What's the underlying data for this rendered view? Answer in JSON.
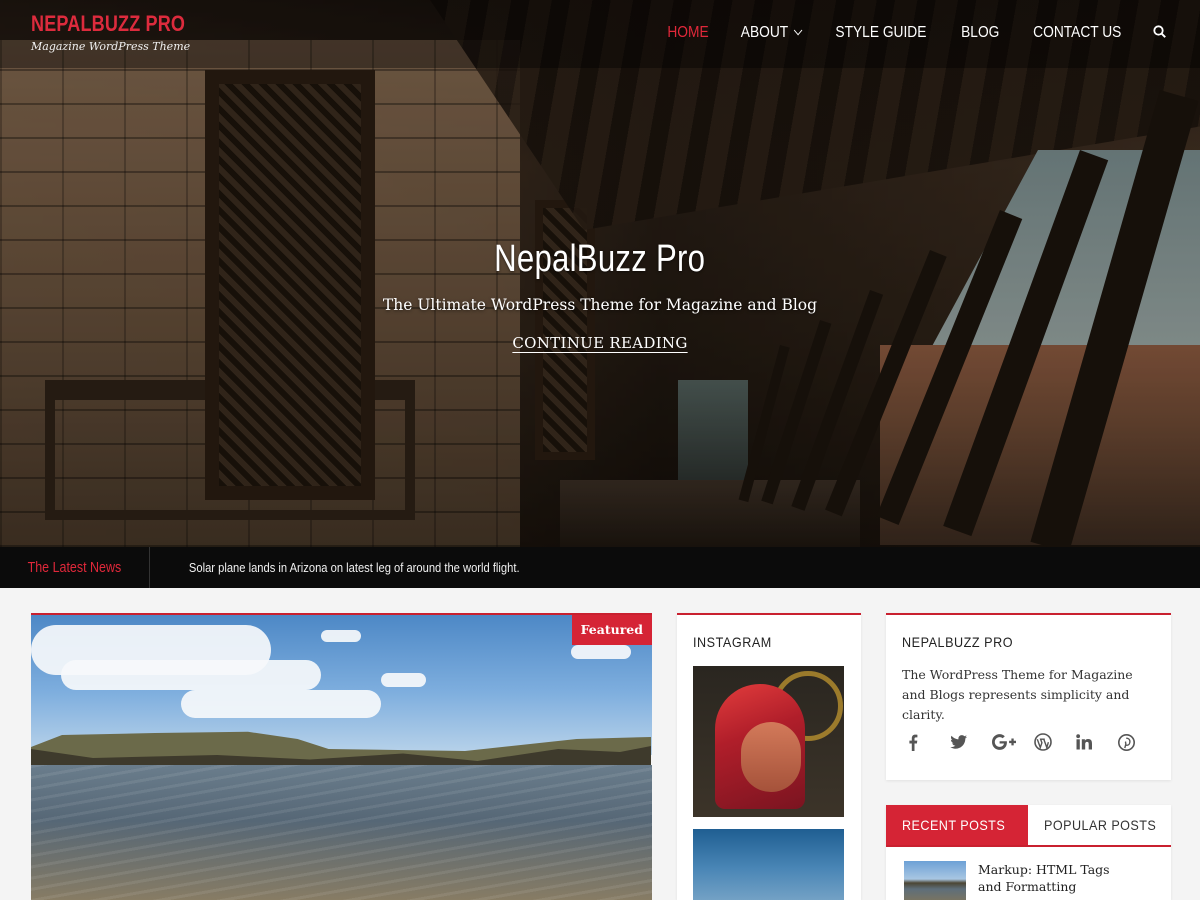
{
  "site": {
    "title": "NEPALBUZZ PRO",
    "tagline": "Magazine WordPress Theme"
  },
  "nav": {
    "items": [
      {
        "label": "HOME",
        "active": true
      },
      {
        "label": "ABOUT",
        "has_dropdown": true
      },
      {
        "label": "STYLE GUIDE"
      },
      {
        "label": "BLOG"
      },
      {
        "label": "CONTACT US"
      }
    ],
    "search_icon": "search-icon"
  },
  "hero": {
    "title": "NepalBuzz Pro",
    "subtitle": "The Ultimate WordPress Theme for Magazine and Blog",
    "cta": "CONTINUE READING"
  },
  "ticker": {
    "label": "The Latest News",
    "headline": "Solar plane lands in Arizona on latest leg of around the world flight."
  },
  "featured": {
    "badge": "Featured"
  },
  "instagram": {
    "title": "INSTAGRAM"
  },
  "about_widget": {
    "title": "NEPALBUZZ PRO",
    "text": "The WordPress Theme for Magazine and Blogs represents simplicity and clarity.",
    "socials": [
      "facebook-icon",
      "twitter-icon",
      "google-plus-icon",
      "wordpress-icon",
      "linkedin-icon",
      "pinterest-icon"
    ]
  },
  "posts_tabs": {
    "tabs": [
      "RECENT POSTS",
      "POPULAR POSTS"
    ],
    "active_tab": "RECENT POSTS",
    "recent": [
      {
        "title": "Markup: HTML Tags and Formatting"
      }
    ]
  },
  "colors": {
    "accent": "#d52435",
    "ticker_bg": "#0b0b0b",
    "page_bg": "#f4f4f4"
  }
}
